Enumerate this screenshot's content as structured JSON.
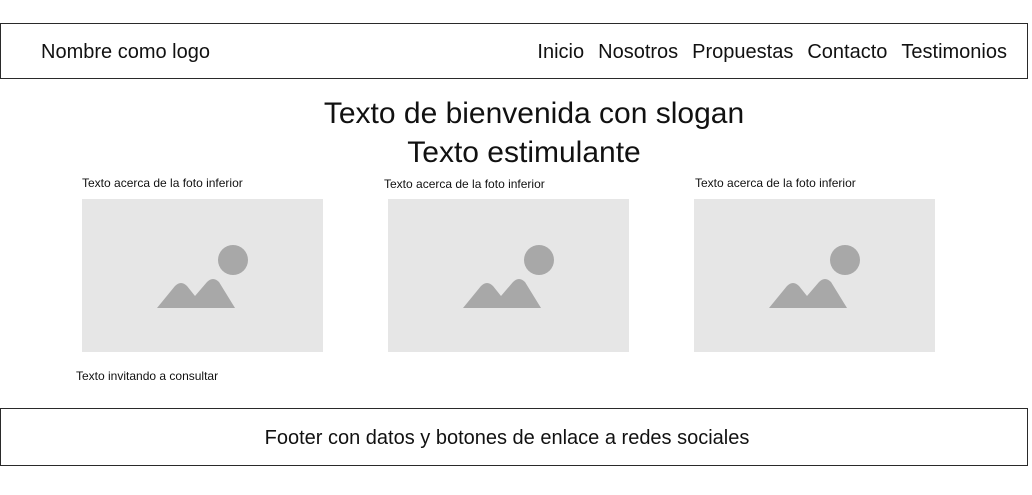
{
  "header": {
    "logo_text": "Nombre como logo",
    "nav": [
      {
        "label": "Inicio"
      },
      {
        "label": "Nosotros"
      },
      {
        "label": "Propuestas"
      },
      {
        "label": "Contacto"
      },
      {
        "label": "Testimonios"
      }
    ]
  },
  "hero": {
    "welcome": "Texto de bienvenida con slogan",
    "subtitle": "Texto estimulante"
  },
  "gallery": [
    {
      "caption": "Texto acerca de la foto inferior",
      "icon": "image-placeholder-icon"
    },
    {
      "caption": "Texto acerca de la foto inferior",
      "icon": "image-placeholder-icon"
    },
    {
      "caption": "Texto acerca de la foto inferior",
      "icon": "image-placeholder-icon"
    }
  ],
  "invite_text": "Texto invitando a consultar",
  "footer": {
    "text": "Footer con datos y botones de enlace a redes sociales"
  },
  "colors": {
    "placeholder_bg": "#e6e6e6",
    "placeholder_icon": "#a8a8a8",
    "border": "#2a2a2a"
  }
}
